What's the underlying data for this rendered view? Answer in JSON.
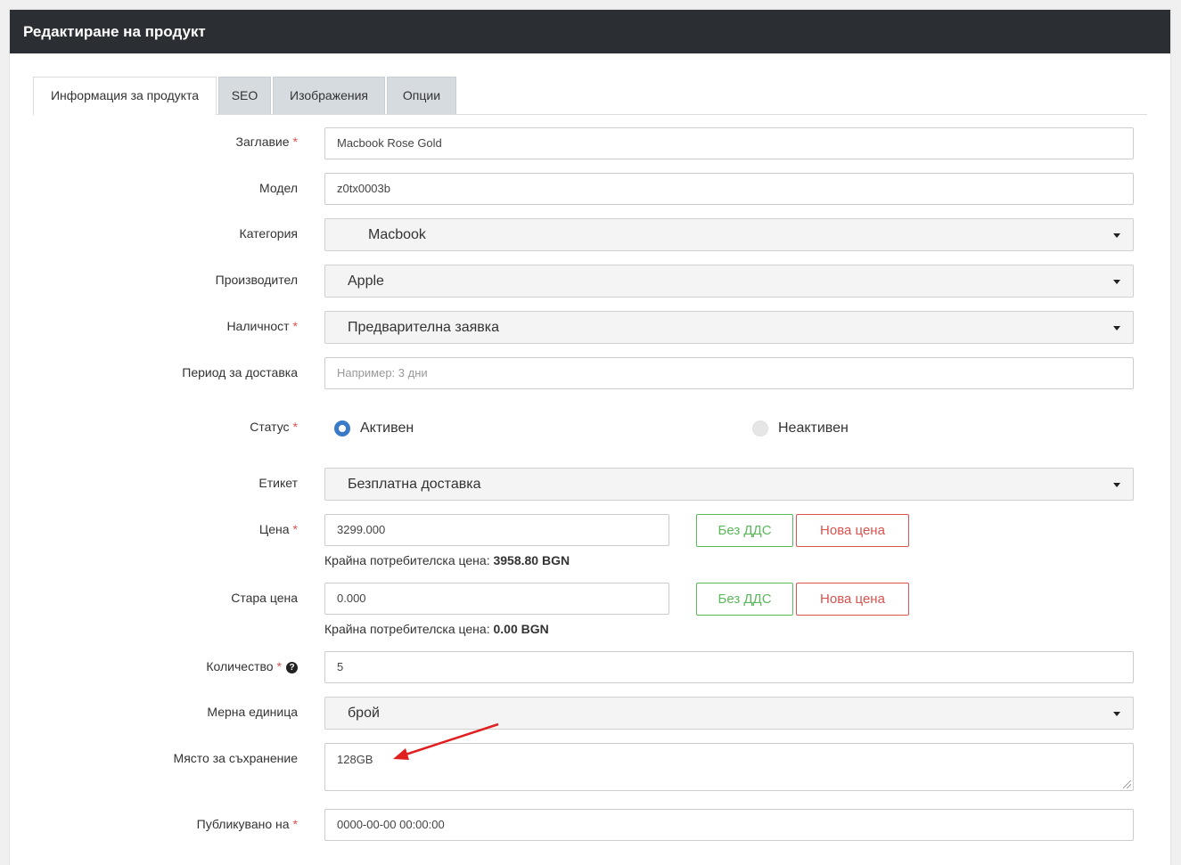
{
  "header": {
    "title": "Редактиране на продукт"
  },
  "tabs": [
    {
      "label": "Информация за продукта",
      "active": true
    },
    {
      "label": "SEO",
      "active": false
    },
    {
      "label": "Изображения",
      "active": false
    },
    {
      "label": "Опции",
      "active": false
    }
  ],
  "form": {
    "title": {
      "label": "Заглавие",
      "required": "*",
      "value": "Macbook Rose Gold"
    },
    "model": {
      "label": "Модел",
      "value": "z0tx0003b"
    },
    "category": {
      "label": "Категория",
      "value": "Macbook"
    },
    "manufacturer": {
      "label": "Производител",
      "value": "Apple"
    },
    "availability": {
      "label": "Наличност",
      "required": "*",
      "value": "Предварителна заявка"
    },
    "delivery_period": {
      "label": "Период за доставка",
      "placeholder": "Например: 3 дни"
    },
    "status": {
      "label": "Статус",
      "required": "*",
      "options": [
        {
          "label": "Активен",
          "checked": true
        },
        {
          "label": "Неактивен",
          "checked": false
        }
      ]
    },
    "tag": {
      "label": "Етикет",
      "value": "Безплатна доставка"
    },
    "price": {
      "label": "Цена",
      "required": "*",
      "value": "3299.000",
      "btn_no_vat": "Без ДДС",
      "btn_new_price": "Нова цена",
      "final_label": "Крайна потребителска цена:",
      "final_value": "3958.80 BGN"
    },
    "old_price": {
      "label": "Стара цена",
      "value": "0.000",
      "btn_no_vat": "Без ДДС",
      "btn_new_price": "Нова цена",
      "final_label": "Крайна потребителска цена:",
      "final_value": "0.00 BGN"
    },
    "quantity": {
      "label": "Количество",
      "required": "*",
      "help_icon": "?",
      "value": "5"
    },
    "unit": {
      "label": "Мерна единица",
      "value": "брой"
    },
    "storage": {
      "label": "Място за съхранение",
      "value": "128GB"
    },
    "published": {
      "label": "Публикувано на",
      "required": "*",
      "value": "0000-00-00 00:00:00"
    }
  },
  "colors": {
    "header_bg": "#2b2e33",
    "annotation_arrow": "#e02020",
    "radio_active": "#3a7bc8",
    "btn_green": "#5cb85c",
    "btn_red": "#d9534f"
  }
}
